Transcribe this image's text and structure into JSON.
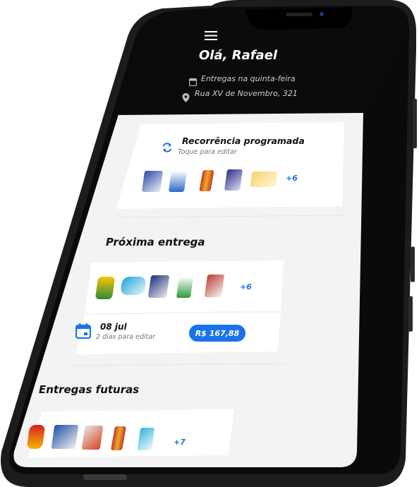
{
  "header": {
    "greeting": "Olá, Rafael",
    "delivery_day": "Entregas na quinta-feira",
    "address": "Rua XV de Novembro, 321"
  },
  "recurrence": {
    "title": "Recorrência programada",
    "subtitle": "Toque para editar",
    "more": "+6"
  },
  "next_delivery": {
    "section_title": "Próxima entrega",
    "more": "+6",
    "date": "08 jul",
    "edit_note": "2 dias para editar",
    "price": "R$ 167,88"
  },
  "future": {
    "section_title": "Entregas futuras",
    "more": "+7"
  },
  "colors": {
    "accent": "#1a73e8",
    "header_bg": "#0b0b0b",
    "screen_bg": "#f3f3f3"
  }
}
